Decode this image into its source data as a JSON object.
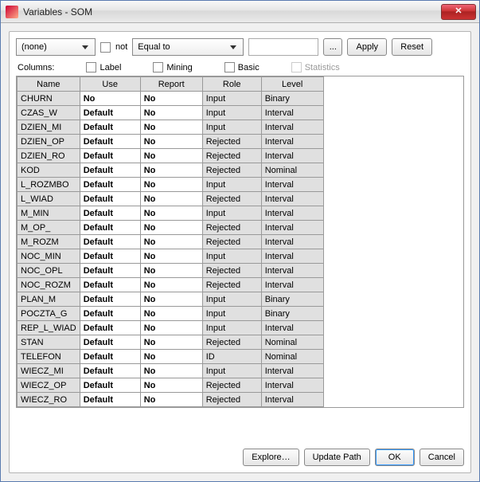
{
  "window": {
    "title": "Variables - SOM"
  },
  "filter": {
    "field_value": "(none)",
    "not_label": "not",
    "op_value": "Equal to",
    "text_value": "",
    "ellipsis": "...",
    "apply": "Apply",
    "reset": "Reset"
  },
  "columns": {
    "label": "Columns:",
    "label_chk": "Label",
    "mining_chk": "Mining",
    "basic_chk": "Basic",
    "stats_chk": "Statistics"
  },
  "table": {
    "headers": [
      "Name",
      "Use",
      "Report",
      "Role",
      "Level"
    ],
    "rows": [
      {
        "name": "CHURN",
        "use": "No",
        "report": "No",
        "role": "Input",
        "level": "Binary"
      },
      {
        "name": "CZAS_W",
        "use": "Default",
        "report": "No",
        "role": "Input",
        "level": "Interval"
      },
      {
        "name": "DZIEN_MI",
        "use": "Default",
        "report": "No",
        "role": "Input",
        "level": "Interval"
      },
      {
        "name": "DZIEN_OP",
        "use": "Default",
        "report": "No",
        "role": "Rejected",
        "level": "Interval"
      },
      {
        "name": "DZIEN_RO",
        "use": "Default",
        "report": "No",
        "role": "Rejected",
        "level": "Interval"
      },
      {
        "name": "KOD",
        "use": "Default",
        "report": "No",
        "role": "Rejected",
        "level": "Nominal"
      },
      {
        "name": "L_ROZMBO",
        "use": "Default",
        "report": "No",
        "role": "Input",
        "level": "Interval"
      },
      {
        "name": "L_WIAD",
        "use": "Default",
        "report": "No",
        "role": "Rejected",
        "level": "Interval"
      },
      {
        "name": "M_MIN",
        "use": "Default",
        "report": "No",
        "role": "Input",
        "level": "Interval"
      },
      {
        "name": "M_OP_",
        "use": "Default",
        "report": "No",
        "role": "Rejected",
        "level": "Interval"
      },
      {
        "name": "M_ROZM",
        "use": "Default",
        "report": "No",
        "role": "Rejected",
        "level": "Interval"
      },
      {
        "name": "NOC_MIN",
        "use": "Default",
        "report": "No",
        "role": "Input",
        "level": "Interval"
      },
      {
        "name": "NOC_OPL",
        "use": "Default",
        "report": "No",
        "role": "Rejected",
        "level": "Interval"
      },
      {
        "name": "NOC_ROZM",
        "use": "Default",
        "report": "No",
        "role": "Rejected",
        "level": "Interval"
      },
      {
        "name": "PLAN_M",
        "use": "Default",
        "report": "No",
        "role": "Input",
        "level": "Binary"
      },
      {
        "name": "POCZTA_G",
        "use": "Default",
        "report": "No",
        "role": "Input",
        "level": "Binary"
      },
      {
        "name": "REP_L_WIAD",
        "use": "Default",
        "report": "No",
        "role": "Input",
        "level": "Interval"
      },
      {
        "name": "STAN",
        "use": "Default",
        "report": "No",
        "role": "Rejected",
        "level": "Nominal"
      },
      {
        "name": "TELEFON",
        "use": "Default",
        "report": "No",
        "role": "ID",
        "level": "Nominal"
      },
      {
        "name": "WIECZ_MI",
        "use": "Default",
        "report": "No",
        "role": "Input",
        "level": "Interval"
      },
      {
        "name": "WIECZ_OP",
        "use": "Default",
        "report": "No",
        "role": "Rejected",
        "level": "Interval"
      },
      {
        "name": "WIECZ_RO",
        "use": "Default",
        "report": "No",
        "role": "Rejected",
        "level": "Interval"
      }
    ]
  },
  "footer": {
    "explore": "Explore…",
    "update": "Update Path",
    "ok": "OK",
    "cancel": "Cancel"
  }
}
